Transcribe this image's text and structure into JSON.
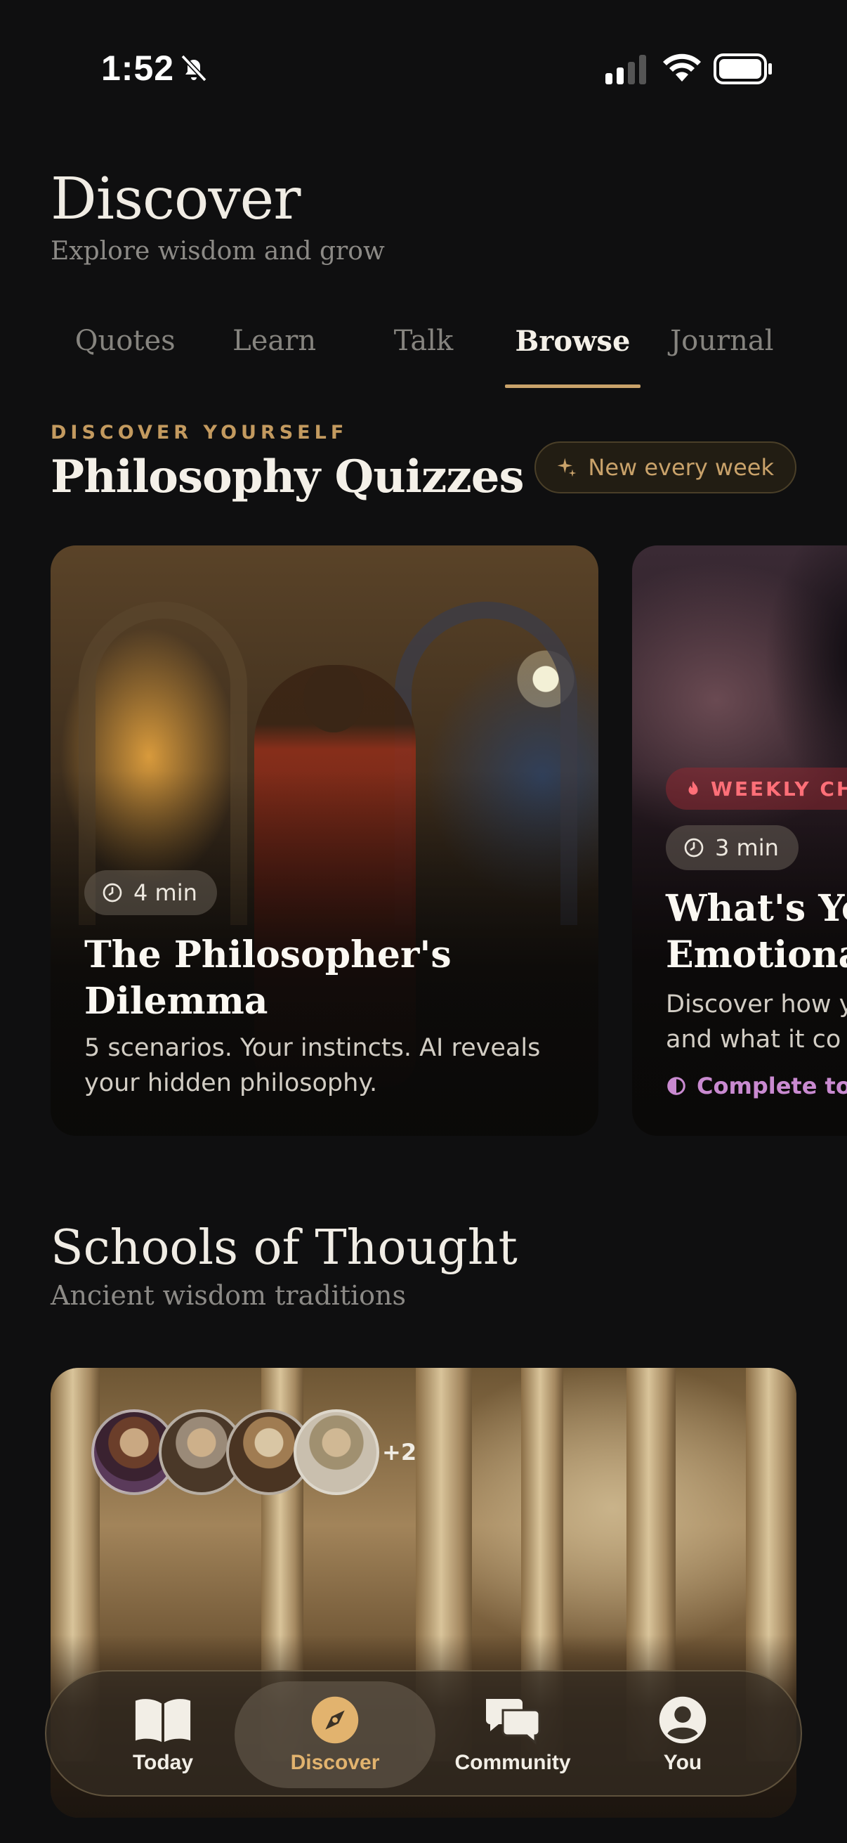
{
  "status": {
    "time": "1:52"
  },
  "header": {
    "title": "Discover",
    "subtitle": "Explore wisdom and grow"
  },
  "tabs": [
    {
      "label": "Quotes",
      "active": false
    },
    {
      "label": "Learn",
      "active": false
    },
    {
      "label": "Talk",
      "active": false
    },
    {
      "label": "Browse",
      "active": true
    },
    {
      "label": "Journal",
      "active": false
    }
  ],
  "quizzes": {
    "eyebrow": "DISCOVER YOURSELF",
    "title": "Philosophy Quizzes",
    "badge": "New every week",
    "cards": [
      {
        "duration": "4 min",
        "title_line1": "The Philosopher's",
        "title_line2": "Dilemma",
        "desc_line1": "5 scenarios. Your instincts. AI reveals",
        "desc_line2": "your hidden philosophy."
      },
      {
        "tag": "WEEKLY CH",
        "duration": "3 min",
        "title_line1": "What's You",
        "title_line2": "Emotional",
        "desc_line1": "Discover how y",
        "desc_line2": "and what it co",
        "footer": "Complete to"
      }
    ]
  },
  "schools": {
    "title": "Schools of Thought",
    "subtitle": "Ancient wisdom traditions",
    "more_count": "+2"
  },
  "tabbar": {
    "items": [
      {
        "label": "Today",
        "icon": "book-icon"
      },
      {
        "label": "Discover",
        "icon": "compass-icon",
        "active": true
      },
      {
        "label": "Community",
        "icon": "chat-bubbles-icon"
      },
      {
        "label": "You",
        "icon": "person-icon"
      }
    ]
  },
  "colors": {
    "accent": "#c9a26a",
    "background": "#0f0f10",
    "weekly": "#ff6f78",
    "complete": "#c98ad0"
  }
}
